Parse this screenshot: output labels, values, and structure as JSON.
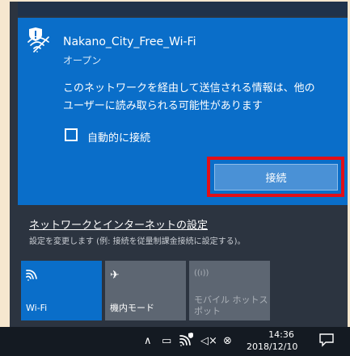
{
  "network": {
    "ssid": "Nakano_City_Free_Wi-Fi",
    "status": "オープン",
    "warning_line1": "このネットワークを経由して送信される情報は、他の",
    "warning_line2": "ユーザーに読み取られる可能性があります",
    "auto_connect_label": "自動的に接続",
    "auto_connect_checked": false,
    "connect_label": "接続"
  },
  "settings": {
    "link": "ネットワークとインターネットの設定",
    "description": "設定を変更します (例: 接続を従量制課金接続に設定する)。"
  },
  "quick_actions": [
    {
      "label": "Wi-Fi",
      "icon": "wifi-icon",
      "active": true
    },
    {
      "label": "機内モード",
      "icon": "airplane-icon",
      "active": false
    },
    {
      "label_line1": "モバイル ホットス",
      "label_line2": "ポット",
      "icon": "hotspot-icon",
      "active": false,
      "disabled": true
    }
  ],
  "taskbar": {
    "time": "14:36",
    "date": "2018/12/10",
    "icons": [
      "chevron-up-icon",
      "battery-icon",
      "wifi-icon",
      "volume-muted-icon",
      "notification-icon",
      "action-center-icon"
    ]
  },
  "colors": {
    "accent": "#0a6ec9",
    "highlight_box": "#e20f17",
    "panel_bg": "#2c3440",
    "taskbar_bg": "#141a22"
  }
}
